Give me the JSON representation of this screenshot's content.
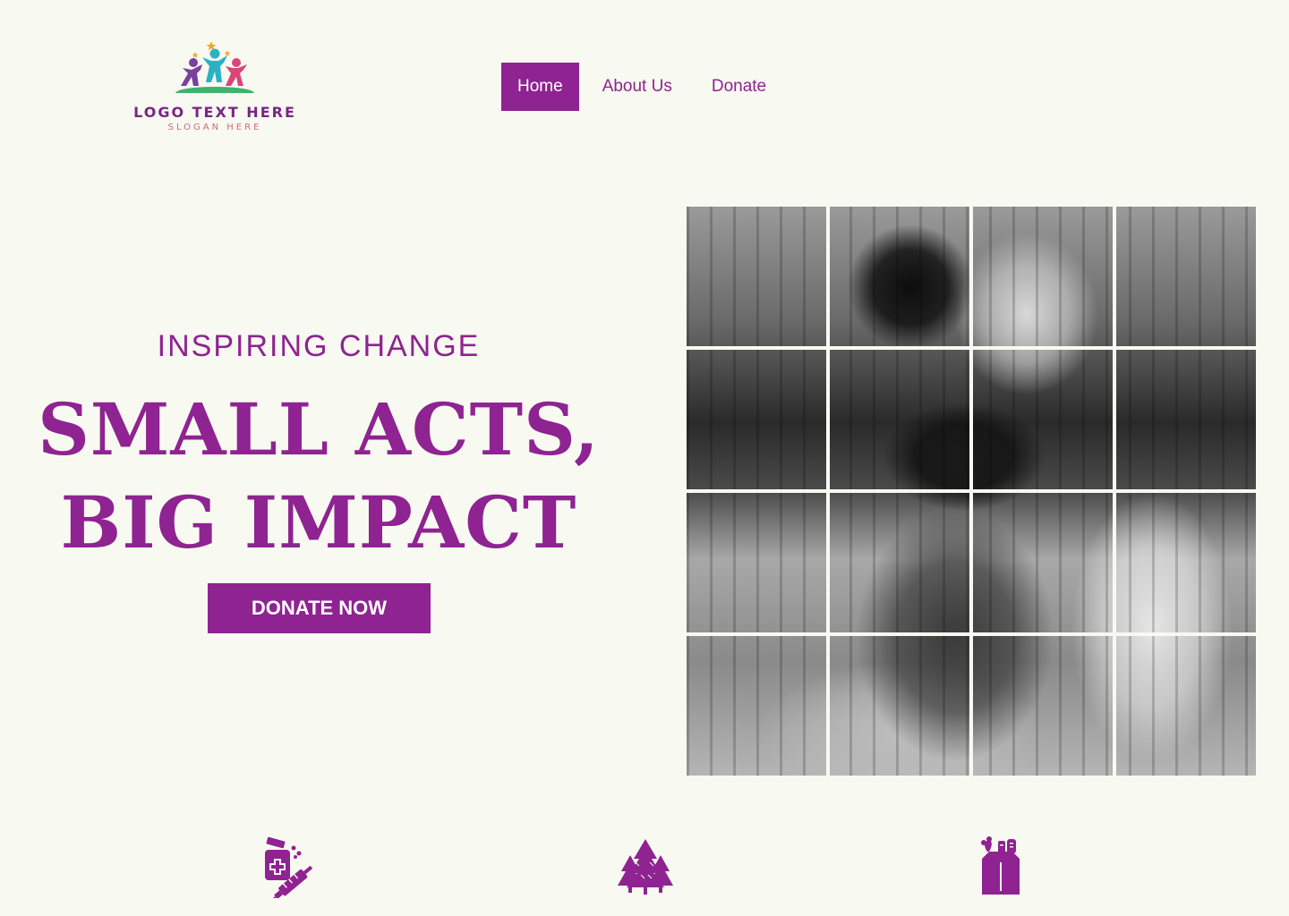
{
  "logo": {
    "text": "LOGO TEXT HERE",
    "slogan": "SLOGAN HERE"
  },
  "nav": {
    "items": [
      {
        "label": "Home",
        "active": true
      },
      {
        "label": "About Us",
        "active": false
      },
      {
        "label": "Donate",
        "active": false
      }
    ]
  },
  "hero": {
    "kicker": "INSPIRING CHANGE",
    "title_line1": "SMALL ACTS,",
    "title_line2": "BIG IMPACT",
    "cta_label": "DONATE NOW"
  },
  "photo": {
    "description": "",
    "tiles": 16
  },
  "features": {
    "icons": [
      "medicine-icon",
      "trees-icon",
      "grocery-bag-icon"
    ]
  },
  "colors": {
    "accent": "#8e2391",
    "background": "#f8f9f1",
    "button_text": "#ffffff"
  }
}
